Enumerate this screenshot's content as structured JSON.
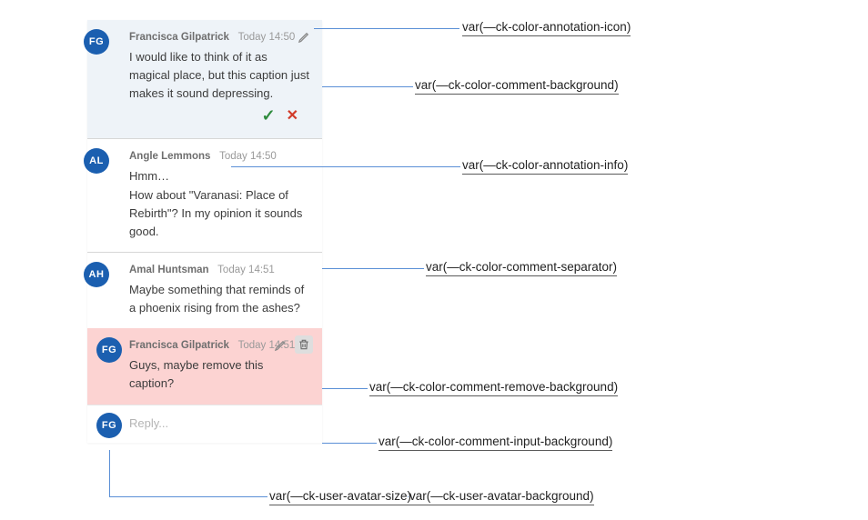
{
  "comments": [
    {
      "initials": "FG",
      "author": "Francisca Gilpatrick",
      "time": "Today 14:50",
      "body": "I would like to think of it as magical place, but this caption just makes it sound depressing."
    },
    {
      "initials": "AL",
      "author": "Angle Lemmons",
      "time": "Today 14:50",
      "body": "Hmm…\nHow about \"Varanasi: Place of Rebirth\"? In my opinion it sounds good."
    },
    {
      "initials": "AH",
      "author": "Amal Huntsman",
      "time": "Today 14:51",
      "body": "Maybe something that reminds of a phoenix rising from the ashes?"
    },
    {
      "initials": "FG",
      "author": "Francisca Gilpatrick",
      "time": "Today 14:51",
      "body": "Guys, maybe remove this caption?"
    }
  ],
  "reply": {
    "initials": "FG",
    "placeholder": "Reply..."
  },
  "callouts": {
    "annotation_icon": "var(—ck-color-annotation-icon)",
    "comment_background": "var(—ck-color-comment-background)",
    "annotation_info": "var(—ck-color-annotation-info)",
    "comment_separator": "var(—ck-color-comment-separator)",
    "remove_background": "var(—ck-color-comment-remove-background)",
    "input_background": "var(—ck-color-comment-input-background)",
    "avatar_size": "var(—ck-user-avatar-size)",
    "avatar_background": "var(—ck-user-avatar-background)"
  }
}
